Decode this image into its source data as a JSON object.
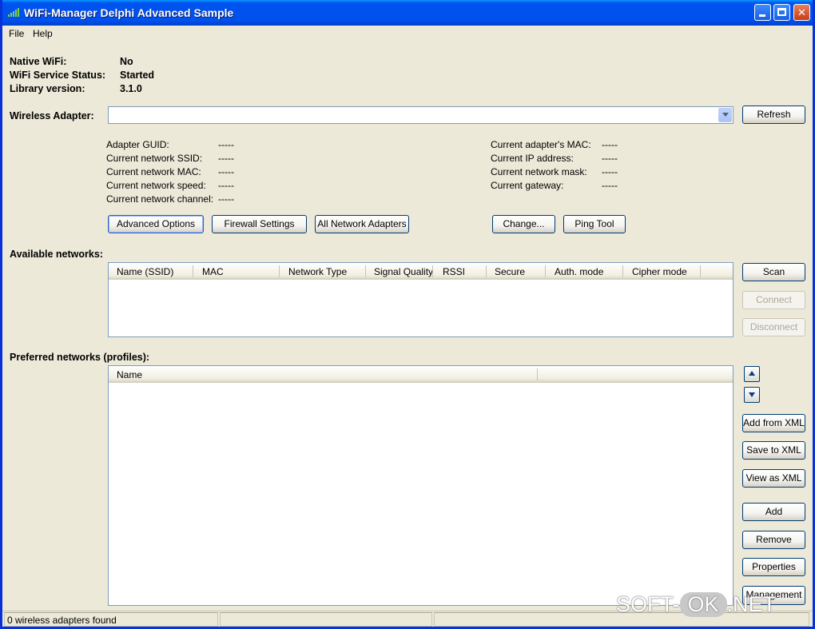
{
  "window": {
    "title": "WiFi-Manager Delphi Advanced Sample"
  },
  "menu": {
    "file": "File",
    "help": "Help"
  },
  "info": {
    "native_wifi_label": "Native WiFi:",
    "native_wifi_value": "No",
    "service_status_label": "WiFi Service Status:",
    "service_status_value": "Started",
    "library_version_label": "Library version:",
    "library_version_value": "3.1.0"
  },
  "adapter": {
    "label": "Wireless Adapter:",
    "selected": "",
    "refresh_button": "Refresh"
  },
  "details_left": [
    {
      "label": "Adapter GUID:",
      "value": "-----"
    },
    {
      "label": "Current network SSID:",
      "value": "-----"
    },
    {
      "label": "Current network MAC:",
      "value": "-----"
    },
    {
      "label": "Current network speed:",
      "value": "-----"
    },
    {
      "label": "Current network channel:",
      "value": "-----"
    }
  ],
  "details_right": [
    {
      "label": "Current adapter's MAC:",
      "value": "-----"
    },
    {
      "label": "Current IP address:",
      "value": "-----"
    },
    {
      "label": "Current network mask:",
      "value": "-----"
    },
    {
      "label": "Current gateway:",
      "value": "-----"
    }
  ],
  "actions": {
    "advanced_options": "Advanced Options",
    "firewall_settings": "Firewall Settings",
    "all_network_adapters": "All Network Adapters",
    "change": "Change...",
    "ping_tool": "Ping Tool"
  },
  "available_networks": {
    "label": "Available networks:",
    "columns": [
      "Name (SSID)",
      "MAC",
      "Network Type",
      "Signal Quality",
      "RSSI",
      "Secure",
      "Auth. mode",
      "Cipher mode"
    ],
    "scan_button": "Scan",
    "connect_button": "Connect",
    "disconnect_button": "Disconnect"
  },
  "preferred_networks": {
    "label": "Preferred networks (profiles):",
    "columns": [
      "Name"
    ],
    "add_from_xml": "Add from XML",
    "save_to_xml": "Save to XML",
    "view_as_xml": "View as XML",
    "add": "Add",
    "remove": "Remove",
    "properties": "Properties",
    "management": "Management"
  },
  "status": {
    "text": "0 wireless adapters found"
  },
  "watermark": {
    "left": "SOFT-",
    "ok": "OK",
    "right": ".NET"
  }
}
